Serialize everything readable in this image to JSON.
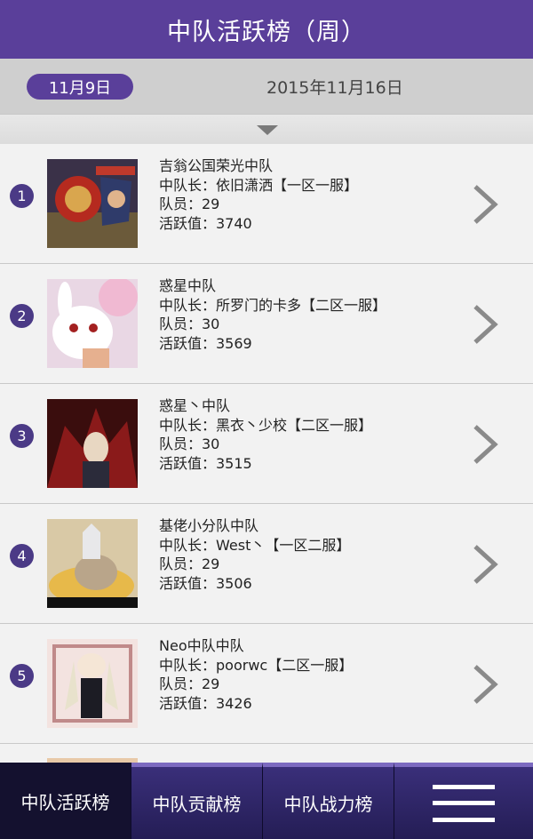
{
  "header": {
    "title": "中队活跃榜（周）"
  },
  "date_range": {
    "start": "11月9日",
    "end": "2015年11月16日"
  },
  "colors": {
    "accent": "#5a3f9a",
    "rank_badge": "#4b3a86",
    "tabbar": "#1b1646"
  },
  "rows": [
    {
      "rank": "1",
      "name": "吉翁公国荣光中队",
      "leader": "中队长：依旧潇洒【一区一服】",
      "members": "队员：29",
      "activity": "活跃值：3740",
      "avatar_icon": "anime-avatar-1"
    },
    {
      "rank": "2",
      "name": "惑星中队",
      "leader": "中队长：所罗门的卡多【二区一服】",
      "members": "队员：30",
      "activity": "活跃值：3569",
      "avatar_icon": "anime-avatar-2"
    },
    {
      "rank": "3",
      "name": "惑星丶中队",
      "leader": "中队长：黑衣丶少校【二区一服】",
      "members": "队员：30",
      "activity": "活跃值：3515",
      "avatar_icon": "anime-avatar-3"
    },
    {
      "rank": "4",
      "name": "基佬小分队中队",
      "leader": "中队长：West丶【一区二服】",
      "members": "队员：29",
      "activity": "活跃值：3506",
      "avatar_icon": "cat-avatar"
    },
    {
      "rank": "5",
      "name": "Neo中队中队",
      "leader": "中队长：poorwc【二区一服】",
      "members": "队员：29",
      "activity": "活跃值：3426",
      "avatar_icon": "anime-avatar-5"
    }
  ],
  "tabs": [
    {
      "label": "中队活跃榜",
      "active": true
    },
    {
      "label": "中队贡献榜",
      "active": false
    },
    {
      "label": "中队战力榜",
      "active": false
    }
  ],
  "menu": {
    "icon": "hamburger-menu-icon"
  }
}
